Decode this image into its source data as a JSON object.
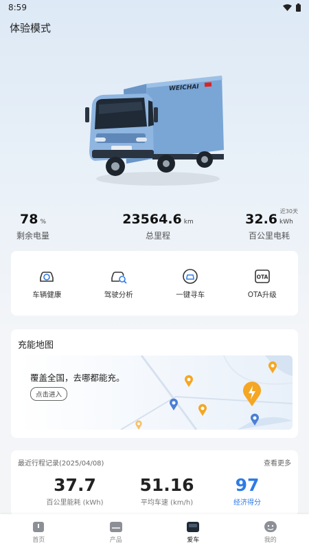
{
  "status": {
    "time": "8:59"
  },
  "header": {
    "title": "体验模式"
  },
  "stats": {
    "battery": {
      "value": "78",
      "unit": "%",
      "label": "剩余电量"
    },
    "mileage": {
      "value": "23564.6",
      "unit": "km",
      "label": "总里程"
    },
    "energy": {
      "value": "32.6",
      "unit": "kWh",
      "label": "百公里电耗",
      "note": "近30天"
    }
  },
  "quick_actions": [
    {
      "label": "车辆健康",
      "icon": "car-health-icon"
    },
    {
      "label": "驾驶分析",
      "icon": "driving-analysis-icon"
    },
    {
      "label": "一键寻车",
      "icon": "find-car-icon"
    },
    {
      "label": "OTA升级",
      "icon": "ota-icon",
      "icon_text": "OTA"
    }
  ],
  "charge_map": {
    "title": "充能地图",
    "slogan": "覆盖全国，去哪都能充。",
    "enter_label": "点击进入"
  },
  "trip": {
    "title": "最近行程记录(2025/04/08)",
    "more_label": "查看更多",
    "energy": {
      "value": "37.7",
      "label": "百公里能耗 (kWh)"
    },
    "speed": {
      "value": "51.16",
      "label": "平均车速 (km/h)"
    },
    "score": {
      "value": "97",
      "label": "经济得分"
    }
  },
  "truck": {
    "brand_text": "WEICHAI"
  },
  "tabs": [
    {
      "label": "首页",
      "icon": "home-icon"
    },
    {
      "label": "产品",
      "icon": "product-icon"
    },
    {
      "label": "爱车",
      "icon": "my-car-icon",
      "active": true
    },
    {
      "label": "我的",
      "icon": "profile-icon"
    }
  ],
  "colors": {
    "accent": "#2e7be6",
    "pin_orange": "#f5a623",
    "pin_blue": "#4a7fd6",
    "truck_body": "#7aa6d6"
  }
}
